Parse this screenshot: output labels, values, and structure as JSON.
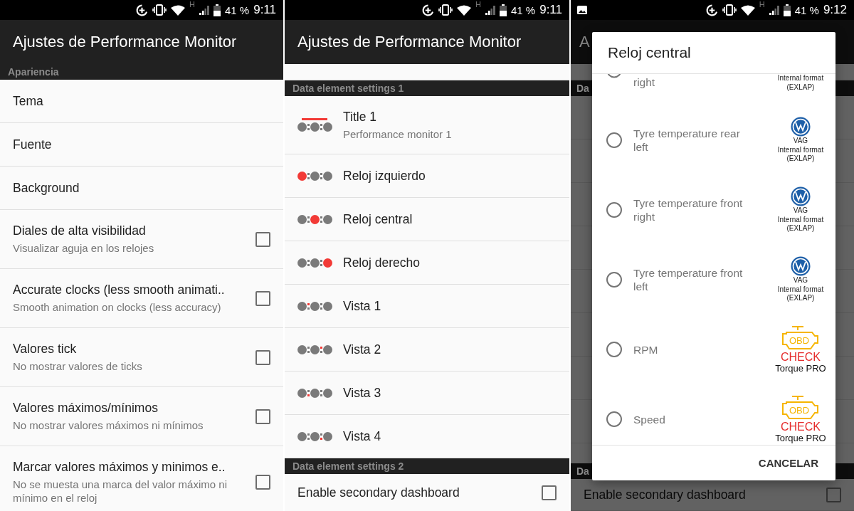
{
  "screens": [
    {
      "kind": "settings",
      "status_bar": {
        "image_notification": false,
        "network": "H",
        "battery": "41 %",
        "time": "9:11"
      },
      "title": "Ajustes de Performance Monitor",
      "cut_row_above": false,
      "sections": [
        {
          "header": "Apariencia",
          "items": [
            {
              "kind": "plain",
              "title": "Tema"
            },
            {
              "kind": "plain",
              "title": "Fuente"
            },
            {
              "kind": "plain",
              "title": "Background"
            },
            {
              "kind": "checkbox",
              "title": "Diales de alta visibilidad",
              "summary": "Visualizar aguja en los relojes",
              "checked": false
            },
            {
              "kind": "checkbox",
              "title": "Accurate clocks (less smooth animati..",
              "summary": "Smooth animation on clocks (less accuracy)",
              "checked": false
            },
            {
              "kind": "checkbox",
              "title": "Valores tick",
              "summary": "No mostrar valores de ticks",
              "checked": false
            },
            {
              "kind": "checkbox",
              "title": "Valores máximos/mínimos",
              "summary": "No mostrar valores máximos ni mínimos",
              "checked": false
            },
            {
              "kind": "checkbox",
              "title": "Marcar valores máximos y minimos e..",
              "summary": "No se muesta una marca del valor máximo ni mínimo en el reloj",
              "checked": false
            }
          ]
        }
      ]
    },
    {
      "kind": "settings",
      "status_bar": {
        "image_notification": false,
        "network": "H",
        "battery": "41 %",
        "time": "9:11"
      },
      "title": "Ajustes de Performance Monitor",
      "cut_row_above": true,
      "sections": [
        {
          "header": "Data element settings 1",
          "items": [
            {
              "kind": "element",
              "title": "Title 1",
              "summary": "Performance monitor 1",
              "bar": true,
              "dots": [
                {
                  "red": false
                },
                {
                  "red": false
                },
                {
                  "red": false
                }
              ],
              "marks": [
                {
                  "red": false
                },
                {
                  "red": false
                },
                {
                  "red": false
                },
                {
                  "red": false
                }
              ]
            },
            {
              "kind": "element",
              "title": "Reloj izquierdo",
              "bar": false,
              "dots": [
                {
                  "red": true
                },
                {
                  "red": false
                },
                {
                  "red": false
                }
              ],
              "marks": [
                {
                  "red": false
                },
                {
                  "red": false
                },
                {
                  "red": false
                },
                {
                  "red": false
                }
              ]
            },
            {
              "kind": "element",
              "title": "Reloj central",
              "bar": false,
              "dots": [
                {
                  "red": false
                },
                {
                  "red": true
                },
                {
                  "red": false
                }
              ],
              "marks": [
                {
                  "red": false
                },
                {
                  "red": false
                },
                {
                  "red": false
                },
                {
                  "red": false
                }
              ]
            },
            {
              "kind": "element",
              "title": "Reloj derecho",
              "bar": false,
              "dots": [
                {
                  "red": false
                },
                {
                  "red": false
                },
                {
                  "red": true
                }
              ],
              "marks": [
                {
                  "red": false
                },
                {
                  "red": false
                },
                {
                  "red": false
                },
                {
                  "red": false
                }
              ]
            },
            {
              "kind": "element",
              "title": "Vista 1",
              "bar": false,
              "dots": [
                {
                  "red": false
                },
                {
                  "red": false
                },
                {
                  "red": false
                }
              ],
              "marks": [
                {
                  "red": true
                },
                {
                  "red": false
                },
                {
                  "red": false
                },
                {
                  "red": false
                }
              ]
            },
            {
              "kind": "element",
              "title": "Vista 2",
              "bar": false,
              "dots": [
                {
                  "red": false
                },
                {
                  "red": false
                },
                {
                  "red": false
                }
              ],
              "marks": [
                {
                  "red": false
                },
                {
                  "red": true
                },
                {
                  "red": false
                },
                {
                  "red": false
                }
              ]
            },
            {
              "kind": "element",
              "title": "Vista 3",
              "bar": false,
              "dots": [
                {
                  "red": false
                },
                {
                  "red": false
                },
                {
                  "red": false
                }
              ],
              "marks": [
                {
                  "red": false
                },
                {
                  "red": false
                },
                {
                  "red": true
                },
                {
                  "red": false
                }
              ]
            },
            {
              "kind": "element",
              "title": "Vista 4",
              "bar": false,
              "dots": [
                {
                  "red": false
                },
                {
                  "red": false
                },
                {
                  "red": false
                }
              ],
              "marks": [
                {
                  "red": false
                },
                {
                  "red": false
                },
                {
                  "red": false
                },
                {
                  "red": true
                }
              ]
            }
          ]
        },
        {
          "header": "Data element settings 2",
          "items": [
            {
              "kind": "checkbox",
              "title": "Enable secondary dashboard",
              "checked": false
            }
          ]
        }
      ]
    },
    {
      "kind": "dialog",
      "status_bar": {
        "image_notification": true,
        "network": "H",
        "battery": "41 %",
        "time": "9:12"
      },
      "title": "A",
      "cut_row_above": true,
      "sections": [
        {
          "header": "Da"
        },
        {
          "header": "Da",
          "items": [
            {
              "kind": "checkbox",
              "title": "Enable secondary dashboard",
              "checked": false
            }
          ]
        }
      ],
      "dialog": {
        "title": "Reloj central",
        "options": [
          {
            "label": "right",
            "selected": false,
            "partial": true,
            "source": {
              "kind": "vag",
              "lines": [
                "Internal format",
                "(EXLAP)"
              ]
            }
          },
          {
            "label": "Tyre temperature rear left",
            "selected": false,
            "partial": false,
            "source": {
              "kind": "vag",
              "lines": [
                "VAG",
                "Internal format",
                "(EXLAP)"
              ]
            }
          },
          {
            "label": "Tyre temperature front right",
            "selected": false,
            "partial": false,
            "source": {
              "kind": "vag",
              "lines": [
                "VAG",
                "Internal format",
                "(EXLAP)"
              ]
            }
          },
          {
            "label": "Tyre temperature front left",
            "selected": false,
            "partial": false,
            "source": {
              "kind": "vag",
              "lines": [
                "VAG",
                "Internal format",
                "(EXLAP)"
              ]
            }
          },
          {
            "label": "RPM",
            "selected": false,
            "partial": false,
            "source": {
              "kind": "torque",
              "badge": "OBD",
              "check": "CHECK",
              "name": "Torque PRO"
            }
          },
          {
            "label": "Speed",
            "selected": false,
            "partial": false,
            "source": {
              "kind": "torque",
              "badge": "OBD",
              "check": "CHECK",
              "name": "Torque PRO"
            }
          }
        ],
        "buttons": [
          "CANCELAR"
        ]
      }
    }
  ]
}
